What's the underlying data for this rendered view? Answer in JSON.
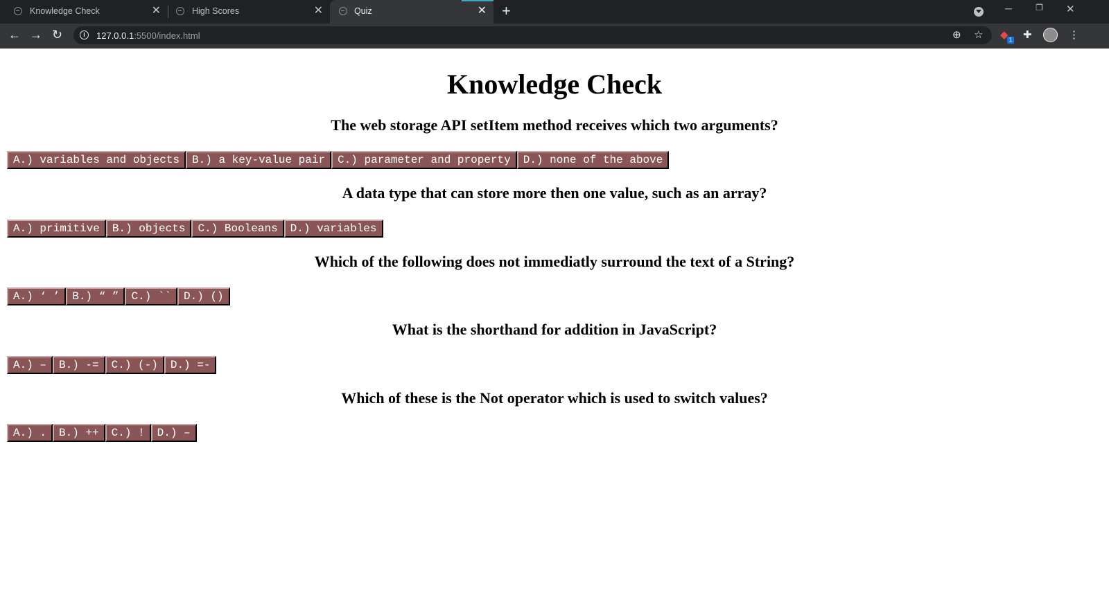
{
  "browser": {
    "tabs": [
      {
        "title": "Knowledge Check",
        "active": false
      },
      {
        "title": "High Scores",
        "active": false
      },
      {
        "title": "Quiz",
        "active": true
      }
    ],
    "url_host": "127.0.0.1",
    "url_rest": ":5500/index.html",
    "extension_badge": "1",
    "icons": [
      "back-arrow-icon",
      "forward-arrow-icon",
      "reload-icon",
      "info-icon",
      "zoom-icon",
      "star-icon",
      "extension-icon",
      "puzzle-icon",
      "menu-dots-icon"
    ]
  },
  "page": {
    "title": "Knowledge Check",
    "questions": [
      {
        "text": "The web storage API setItem method receives which two arguments?",
        "answers": [
          "A.) variables and objects",
          "B.) a key-value pair",
          "C.) parameter and property",
          "D.) none of the above"
        ]
      },
      {
        "text": "A data type that can store more then one value, such as an array?",
        "answers": [
          "A.) primitive",
          "B.) objects",
          "C.) Booleans",
          "D.) variables"
        ]
      },
      {
        "text": "Which of the following does not immediatly surround the text of a String?",
        "answers": [
          "A.) ‘ ’",
          "B.) “ ”",
          "C.) ``",
          "D.) ()"
        ]
      },
      {
        "text": "What is the shorthand for addition in JavaScript?",
        "answers": [
          "A.) –",
          "B.) -=",
          "C.) (-)",
          "D.) =-"
        ]
      },
      {
        "text": "Which of these is the Not operator which is used to switch values?",
        "answers": [
          "A.) .",
          "B.) ++",
          "C.) !",
          "D.) –"
        ]
      }
    ]
  },
  "colors": {
    "button_bg": "#8a5557",
    "chrome_dark": "#202124",
    "chrome_toolbar": "#35363a"
  }
}
